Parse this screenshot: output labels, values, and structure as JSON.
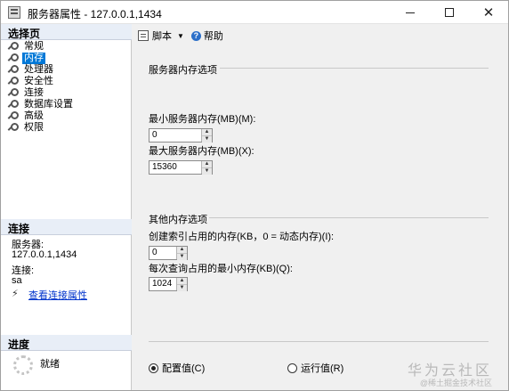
{
  "window": {
    "title": "服务器属性 - 127.0.0.1,1434"
  },
  "left": {
    "select_page_header": "选择页",
    "nav_items": [
      {
        "label": "常规",
        "icon": "wrench-icon"
      },
      {
        "label": "内存",
        "icon": "wrench-icon",
        "selected": true
      },
      {
        "label": "处理器",
        "icon": "wrench-icon"
      },
      {
        "label": "安全性",
        "icon": "wrench-icon"
      },
      {
        "label": "连接",
        "icon": "wrench-icon"
      },
      {
        "label": "数据库设置",
        "icon": "wrench-icon"
      },
      {
        "label": "高级",
        "icon": "wrench-icon"
      },
      {
        "label": "权限",
        "icon": "wrench-icon"
      }
    ],
    "connection_header": "连接",
    "server_label": "服务器:",
    "server_value": "127.0.0.1,1434",
    "connection_label": "连接:",
    "connection_value": "sa",
    "view_connection_link": "查看连接属性",
    "progress_header": "进度",
    "progress_status": "就绪"
  },
  "toolbar": {
    "script_label": "脚本",
    "help_label": "帮助"
  },
  "content": {
    "memory_group_title": "服务器内存选项",
    "min_memory_label": "最小服务器内存(MB)(M):",
    "min_memory_value": "0",
    "max_memory_label": "最大服务器内存(MB)(X):",
    "max_memory_value": "15360",
    "other_group_title": "其他内存选项",
    "index_memory_label": "创建索引占用的内存(KB，0 = 动态内存)(I):",
    "index_memory_value": "0",
    "min_query_label": "每次查询占用的最小内存(KB)(Q):",
    "min_query_value": "1024",
    "radio_config": "配置值(C)",
    "radio_running": "运行值(R)",
    "selected_radio": "config"
  },
  "watermark": {
    "main": "华为云社区",
    "sub": "@稀土掘金技术社区"
  }
}
